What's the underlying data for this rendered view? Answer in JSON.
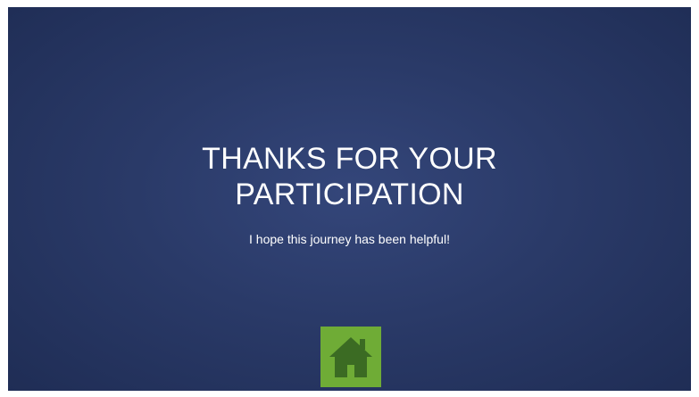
{
  "slide": {
    "title_line_1": "THANKS FOR YOUR",
    "title_line_2": "PARTICIPATION",
    "subtitle": "I hope this journey has been helpful!"
  },
  "home_button": {
    "icon": "home-icon",
    "background_color": "#6fac36",
    "icon_color": "#3b6b23"
  },
  "colors": {
    "slide_background": "#2a3a68",
    "text": "#ffffff"
  }
}
